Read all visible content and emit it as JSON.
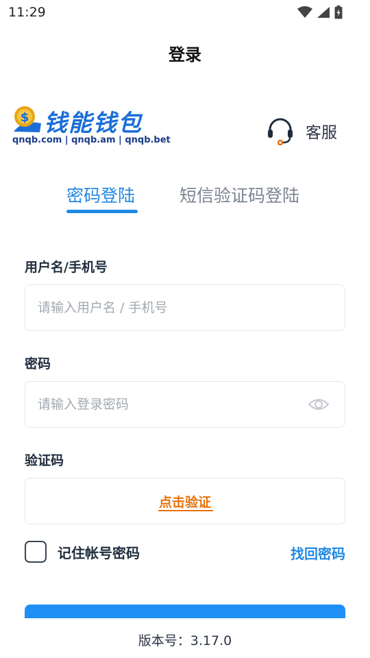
{
  "status_bar": {
    "time": "11:29"
  },
  "header": {
    "title": "登录"
  },
  "brand": {
    "name": "钱能钱包",
    "domains": "qnqb.com | qnqb.am | qnqb.bet",
    "colors": {
      "primary": "#1a6ed8",
      "gold": "#e8a317"
    }
  },
  "customer_service": {
    "label": "客服",
    "icon": "headset-icon"
  },
  "tabs": [
    {
      "label": "密码登陆",
      "active": true
    },
    {
      "label": "短信验证码登陆",
      "active": false
    }
  ],
  "form": {
    "username": {
      "label": "用户名/手机号",
      "placeholder": "请输入用户名 / 手机号",
      "value": ""
    },
    "password": {
      "label": "密码",
      "placeholder": "请输入登录密码",
      "value": "",
      "toggle_icon": "eye-icon"
    },
    "captcha": {
      "label": "验证码",
      "action": "点击验证"
    },
    "remember": {
      "label": "记住帐号密码",
      "checked": false
    },
    "forgot": "找回密码"
  },
  "footer": {
    "version": "版本号：3.17.0"
  },
  "colors": {
    "accent": "#1e88e5",
    "warning": "#e8710a",
    "button": "#1e90f5"
  }
}
